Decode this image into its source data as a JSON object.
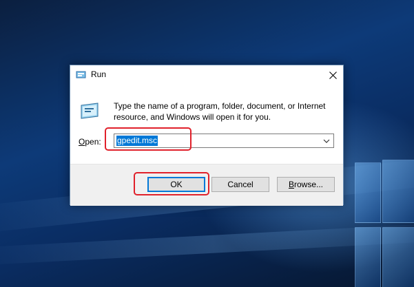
{
  "dialog": {
    "title": "Run",
    "prompt": "Type the name of a program, folder, document, or Internet resource, and Windows will open it for you.",
    "open_label_u": "O",
    "open_label_rest": "pen:",
    "input_value": "gpedit.msc",
    "buttons": {
      "ok": "OK",
      "cancel": "Cancel",
      "browse_u": "B",
      "browse_rest": "rowse..."
    }
  },
  "colors": {
    "accent": "#0078d7",
    "highlight": "#e0202a"
  },
  "icons": [
    "run-icon",
    "close-icon",
    "run-app-icon",
    "chevron-down-icon"
  ]
}
